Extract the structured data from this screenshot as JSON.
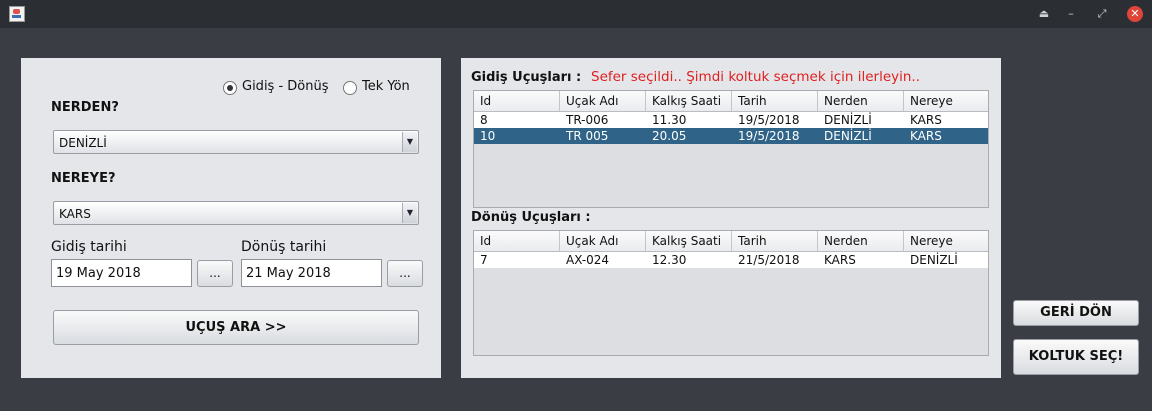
{
  "window": {
    "icons": {
      "app": "java-cup-icon",
      "eject": "eject-icon",
      "minimize": "minimize-icon",
      "maximize": "maximize-icon",
      "close": "close-icon"
    }
  },
  "left": {
    "trip_type": {
      "options": [
        {
          "label": "Gidiş - Dönüş",
          "selected": true
        },
        {
          "label": "Tek Yön",
          "selected": false
        }
      ]
    },
    "from_label": "NERDEN?",
    "from_value": "DENİZLİ",
    "to_label": "NEREYE?",
    "to_value": "KARS",
    "depart_label": "Gidiş tarihi",
    "depart_value": "19 May 2018",
    "return_label": "Dönüş tarihi",
    "return_value": "21 May 2018",
    "date_button": "...",
    "search_button": "UÇUŞ ARA >>"
  },
  "right": {
    "outbound_title": "Gidiş Uçuşları :",
    "status_message": "Sefer seçildi.. Şimdi koltuk seçmek için ilerleyin..",
    "status_color": "#e02020",
    "return_title": "Dönüş Uçuşları :",
    "columns": [
      "Id",
      "Uçak Adı",
      "Kalkış Saati",
      "Tarih",
      "Nerden",
      "Nereye"
    ],
    "outbound_rows": [
      {
        "selected": false,
        "cells": [
          "8",
          "TR-006",
          "11.30",
          "19/5/2018",
          "DENİZLİ",
          "KARS"
        ]
      },
      {
        "selected": true,
        "cells": [
          "10",
          "TR 005",
          "20.05",
          "19/5/2018",
          "DENİZLİ",
          "KARS"
        ]
      }
    ],
    "return_rows": [
      {
        "selected": false,
        "cells": [
          "7",
          "AX-024",
          "12.30",
          "21/5/2018",
          "KARS",
          "DENİZLİ"
        ]
      }
    ],
    "selection_color": "#2f6387"
  },
  "actions": {
    "back_button": "GERİ DÖN",
    "seat_button": "KOLTUK SEÇ!"
  }
}
